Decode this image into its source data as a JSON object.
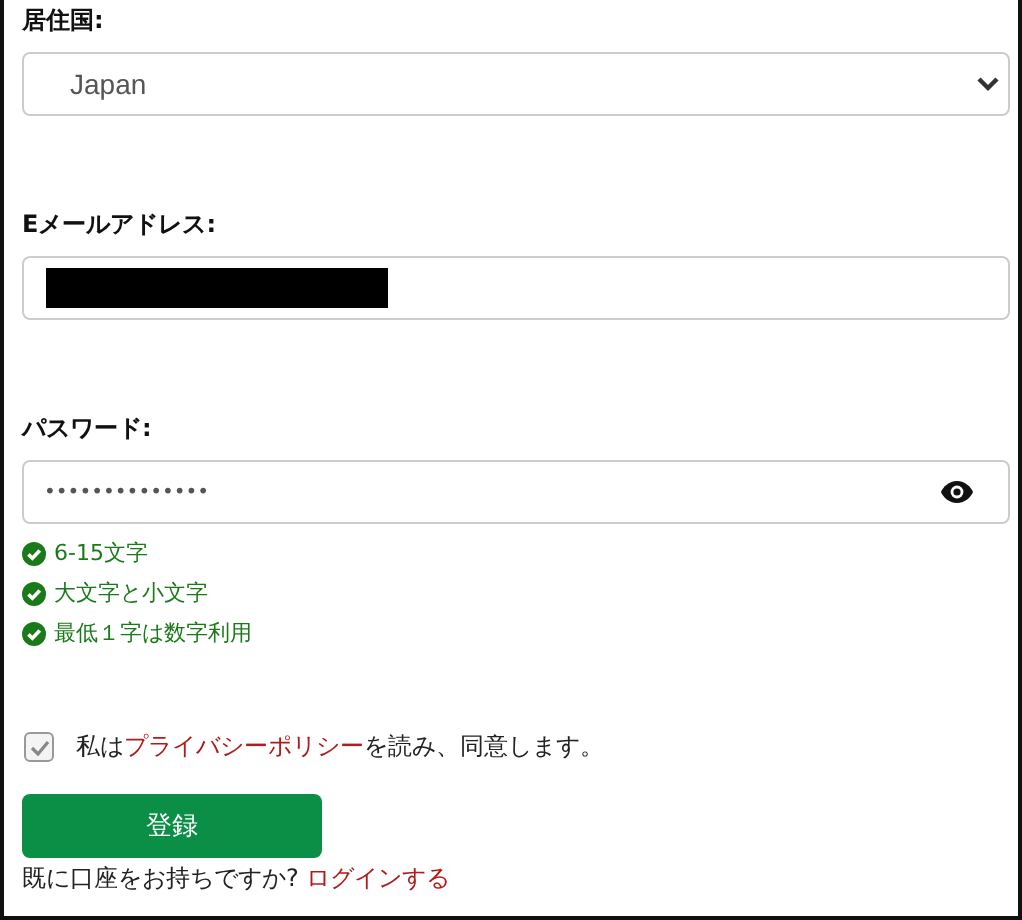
{
  "country": {
    "label": "居住国:",
    "value": "Japan"
  },
  "email": {
    "label": "Eメールアドレス:",
    "redacted": true
  },
  "password": {
    "label": "パスワード:",
    "value": "••••••••••••••"
  },
  "rules": [
    {
      "text": "6-15文字",
      "met": true
    },
    {
      "text": "大文字と小文字",
      "met": true
    },
    {
      "text": "最低１字は数字利用",
      "met": true
    }
  ],
  "consent": {
    "checked": true,
    "before": "私は",
    "link": "プライバシーポリシー",
    "after": "を読み、同意します。"
  },
  "submit": "登録",
  "login": {
    "text": "既に口座をお持ちですか?",
    "link": "ログインする"
  }
}
